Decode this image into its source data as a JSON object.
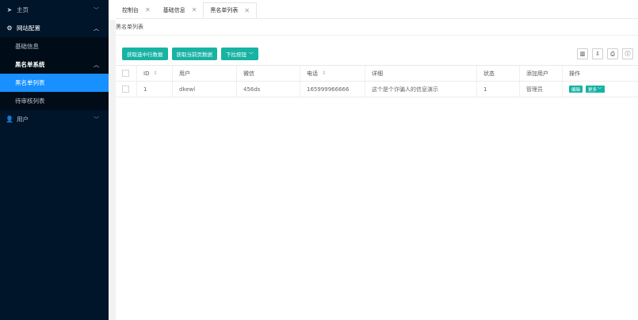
{
  "sidebar": {
    "home": "主页",
    "site_config": "网站配置",
    "basic_info": "基础信息",
    "blacklist_system": "黑名单系统",
    "blacklist_list": "黑名单列表",
    "pending_list": "待审核列表",
    "users": "用户"
  },
  "tabs": [
    {
      "label": "控制台"
    },
    {
      "label": "基础信息"
    },
    {
      "label": "黑名单列表"
    }
  ],
  "breadcrumb": "黑名单列表",
  "toolbar": {
    "get_selected": "获取选中行数据",
    "get_current_page": "获取当前页数据",
    "dropdown": "下拉按钮"
  },
  "table": {
    "columns": [
      "ID",
      "用户",
      "微信",
      "电话",
      "详细",
      "状态",
      "添加用户",
      "操作"
    ],
    "rows": [
      {
        "id": "1",
        "user": "dkewl",
        "wechat": "456ds",
        "phone": "165999966666",
        "detail": "这个是个诈骗人的信息演示",
        "status": "1",
        "added_by": "管理员",
        "edit": "编辑",
        "more": "更多"
      }
    ]
  },
  "colors": {
    "sidebar_bg": "#001529",
    "active": "#1890ff",
    "button": "#17b3a3"
  }
}
